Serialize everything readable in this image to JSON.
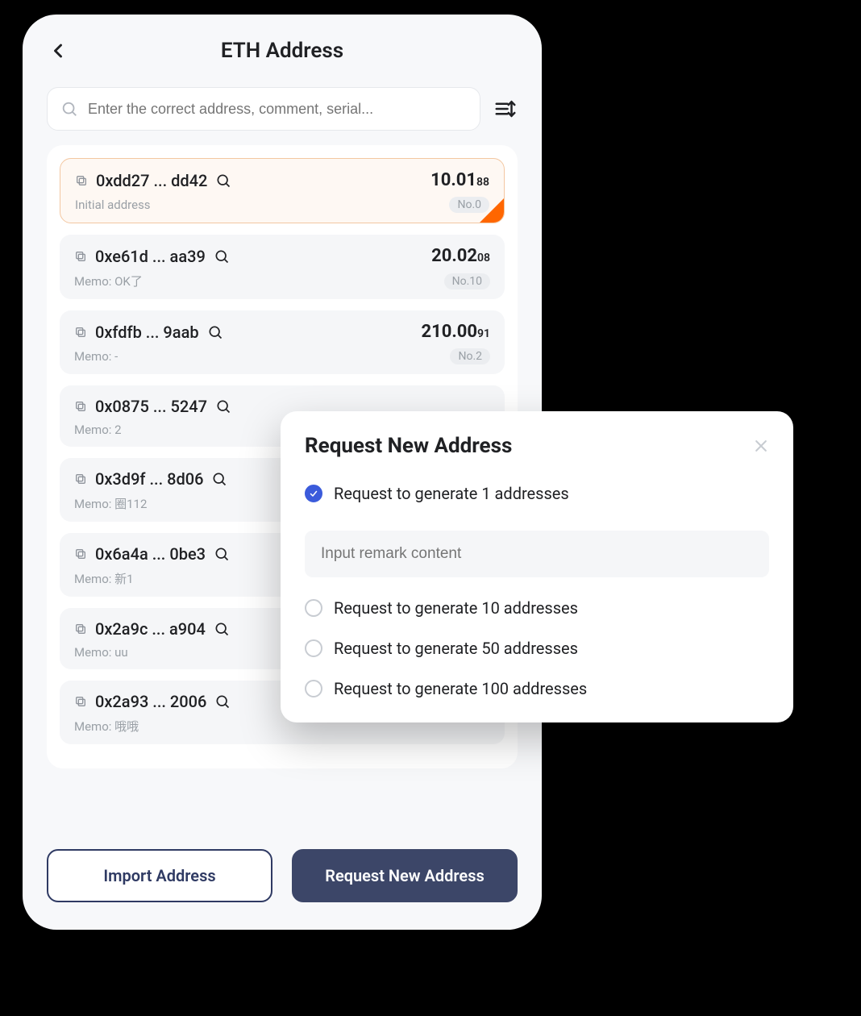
{
  "header": {
    "title": "ETH Address"
  },
  "search": {
    "placeholder": "Enter the correct address, comment, serial..."
  },
  "addresses": [
    {
      "addr": "0xdd27 ... dd42",
      "balance_main": "10.01",
      "balance_sub": "88",
      "memo": "Initial address",
      "index": "No.0",
      "selected": true
    },
    {
      "addr": "0xe61d ... aa39",
      "balance_main": "20.02",
      "balance_sub": "08",
      "memo": "Memo: OK了",
      "index": "No.10",
      "selected": false
    },
    {
      "addr": "0xfdfb ... 9aab",
      "balance_main": "210.00",
      "balance_sub": "91",
      "memo": "Memo: -",
      "index": "No.2",
      "selected": false
    },
    {
      "addr": "0x0875 ... 5247",
      "balance_main": "",
      "balance_sub": "",
      "memo": "Memo: 2",
      "index": "",
      "selected": false
    },
    {
      "addr": "0x3d9f ... 8d06",
      "balance_main": "",
      "balance_sub": "",
      "memo": "Memo: 圈112",
      "index": "",
      "selected": false
    },
    {
      "addr": "0x6a4a ... 0be3",
      "balance_main": "",
      "balance_sub": "",
      "memo": "Memo: 新1",
      "index": "",
      "selected": false
    },
    {
      "addr": "0x2a9c ... a904",
      "balance_main": "",
      "balance_sub": "",
      "memo": "Memo: uu",
      "index": "",
      "selected": false
    },
    {
      "addr": "0x2a93 ... 2006",
      "balance_main": "",
      "balance_sub": "",
      "memo": "Memo: 哦哦",
      "index": "",
      "selected": false
    }
  ],
  "buttons": {
    "import": "Import Address",
    "request": "Request New Address"
  },
  "modal": {
    "title": "Request New Address",
    "options": [
      {
        "label": "Request to generate 1 addresses",
        "checked": true
      },
      {
        "label": "Request to generate 10 addresses",
        "checked": false
      },
      {
        "label": "Request to generate 50 addresses",
        "checked": false
      },
      {
        "label": "Request to generate 100 addresses",
        "checked": false
      }
    ],
    "remark_placeholder": "Input remark content"
  }
}
